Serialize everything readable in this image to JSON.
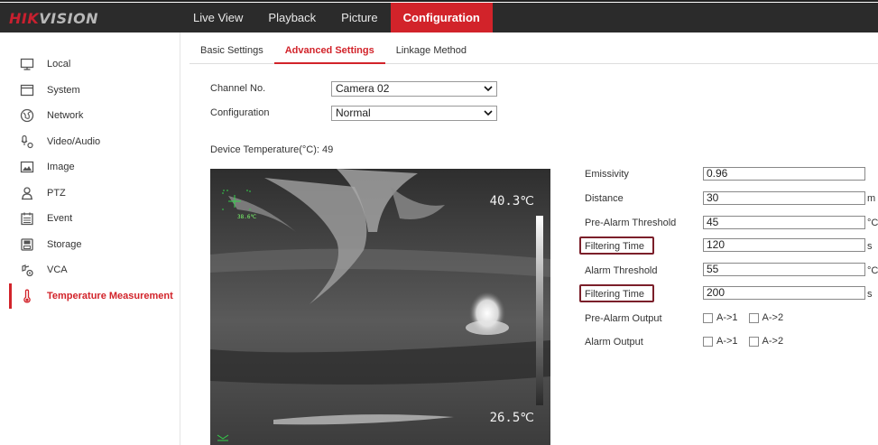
{
  "brand": {
    "part1": "HIK",
    "part2": "VISION"
  },
  "nav": [
    {
      "label": "Live View",
      "active": false
    },
    {
      "label": "Playback",
      "active": false
    },
    {
      "label": "Picture",
      "active": false
    },
    {
      "label": "Configuration",
      "active": true
    }
  ],
  "sidebar": [
    {
      "label": "Local",
      "icon": "monitor-icon"
    },
    {
      "label": "System",
      "icon": "window-icon"
    },
    {
      "label": "Network",
      "icon": "globe-icon"
    },
    {
      "label": "Video/Audio",
      "icon": "mic-camera-icon"
    },
    {
      "label": "Image",
      "icon": "image-icon"
    },
    {
      "label": "PTZ",
      "icon": "person-icon"
    },
    {
      "label": "Event",
      "icon": "calendar-icon"
    },
    {
      "label": "Storage",
      "icon": "storage-icon"
    },
    {
      "label": "VCA",
      "icon": "vca-icon"
    },
    {
      "label": "Temperature Measurement",
      "icon": "thermometer-icon",
      "active": true
    }
  ],
  "subtabs": [
    {
      "label": "Basic Settings",
      "active": false
    },
    {
      "label": "Advanced Settings",
      "active": true
    },
    {
      "label": "Linkage Method",
      "active": false
    }
  ],
  "form": {
    "channel_label": "Channel No.",
    "channel_value": "Camera 02",
    "config_label": "Configuration",
    "config_value": "Normal",
    "device_temp": "Device Temperature(°C): 49"
  },
  "video": {
    "temp_high": "40.3℃",
    "temp_low": "26.5℃",
    "marker_text": "38.6℃"
  },
  "params": {
    "emissivity_label": "Emissivity",
    "emissivity_value": "0.96",
    "distance_label": "Distance",
    "distance_value": "30",
    "distance_unit": "m",
    "prealarm_threshold_label": "Pre-Alarm Threshold",
    "prealarm_threshold_value": "45",
    "prealarm_threshold_unit": "°C",
    "filtering_time_1_label": "Filtering Time",
    "filtering_time_1_value": "120",
    "filtering_time_1_unit": "s",
    "alarm_threshold_label": "Alarm Threshold",
    "alarm_threshold_value": "55",
    "alarm_threshold_unit": "°C",
    "filtering_time_2_label": "Filtering Time",
    "filtering_time_2_value": "200",
    "filtering_time_2_unit": "s",
    "prealarm_output_label": "Pre-Alarm Output",
    "alarm_output_label": "Alarm Output",
    "output_a1": "A->1",
    "output_a2": "A->2"
  },
  "colors": {
    "accent": "#d2232a",
    "header_bg": "#2b2b2b",
    "highlight_box": "#7b1f2a"
  }
}
